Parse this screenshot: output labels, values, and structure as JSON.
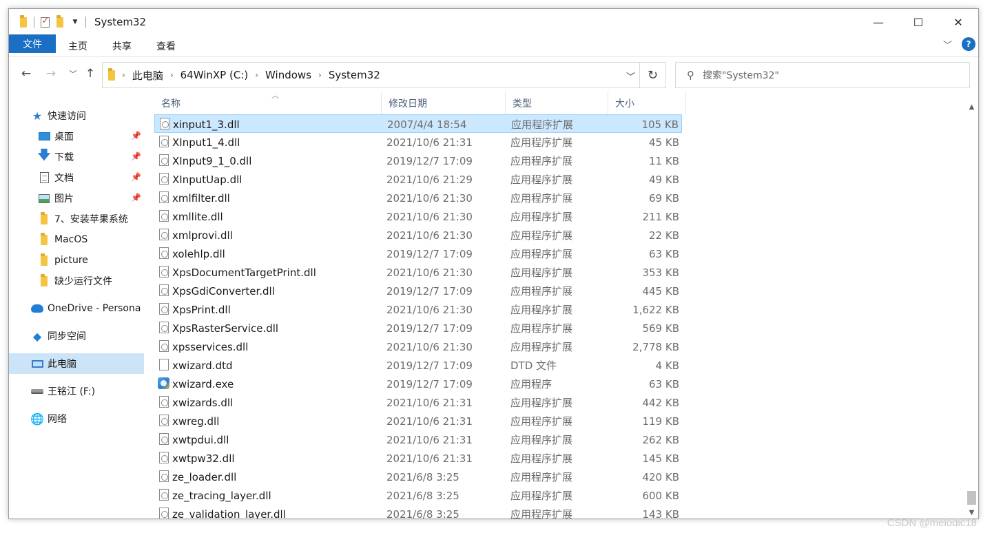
{
  "titlebar": {
    "title": "System32",
    "minimize_glyph": "—",
    "maximize_glyph": "☐",
    "close_glyph": "✕"
  },
  "ribbon": {
    "tabs": [
      "文件",
      "主页",
      "共享",
      "查看"
    ],
    "help_glyph": "?"
  },
  "address": {
    "crumbs": [
      "此电脑",
      "64WinXP  (C:)",
      "Windows",
      "System32"
    ]
  },
  "search": {
    "placeholder": "搜索\"System32\""
  },
  "sidebar": {
    "items": [
      {
        "label": "快速访问",
        "icon": "star-icon"
      },
      {
        "label": "桌面",
        "icon": "desktop-icon",
        "pinned": true
      },
      {
        "label": "下载",
        "icon": "download-icon",
        "pinned": true
      },
      {
        "label": "文档",
        "icon": "documents-icon",
        "pinned": true
      },
      {
        "label": "图片",
        "icon": "pictures-icon",
        "pinned": true
      },
      {
        "label": "7、安装苹果系统",
        "icon": "folder-icon"
      },
      {
        "label": "MacOS",
        "icon": "folder-icon"
      },
      {
        "label": "picture",
        "icon": "folder-icon"
      },
      {
        "label": "缺少运行文件",
        "icon": "folder-icon"
      },
      {
        "label": "OneDrive - Persona",
        "icon": "onedrive-icon"
      },
      {
        "label": "同步空间",
        "icon": "sync-icon"
      },
      {
        "label": "此电脑",
        "icon": "computer-icon",
        "selected": true
      },
      {
        "label": "王铭江 (F:)",
        "icon": "drive-icon"
      },
      {
        "label": "网络",
        "icon": "network-icon"
      }
    ]
  },
  "columns": {
    "name": "名称",
    "date": "修改日期",
    "type": "类型",
    "size": "大小"
  },
  "files": [
    {
      "name": "xinput1_3.dll",
      "date": "2007/4/4 18:54",
      "type": "应用程序扩展",
      "size": "105 KB",
      "icon": "dll",
      "selected": true
    },
    {
      "name": "XInput1_4.dll",
      "date": "2021/10/6 21:31",
      "type": "应用程序扩展",
      "size": "45 KB",
      "icon": "dll"
    },
    {
      "name": "XInput9_1_0.dll",
      "date": "2019/12/7 17:09",
      "type": "应用程序扩展",
      "size": "11 KB",
      "icon": "dll"
    },
    {
      "name": "XInputUap.dll",
      "date": "2021/10/6 21:29",
      "type": "应用程序扩展",
      "size": "49 KB",
      "icon": "dll"
    },
    {
      "name": "xmlfilter.dll",
      "date": "2021/10/6 21:30",
      "type": "应用程序扩展",
      "size": "69 KB",
      "icon": "dll"
    },
    {
      "name": "xmllite.dll",
      "date": "2021/10/6 21:30",
      "type": "应用程序扩展",
      "size": "211 KB",
      "icon": "dll"
    },
    {
      "name": "xmlprovi.dll",
      "date": "2021/10/6 21:30",
      "type": "应用程序扩展",
      "size": "22 KB",
      "icon": "dll"
    },
    {
      "name": "xolehlp.dll",
      "date": "2019/12/7 17:09",
      "type": "应用程序扩展",
      "size": "63 KB",
      "icon": "dll"
    },
    {
      "name": "XpsDocumentTargetPrint.dll",
      "date": "2021/10/6 21:30",
      "type": "应用程序扩展",
      "size": "353 KB",
      "icon": "dll"
    },
    {
      "name": "XpsGdiConverter.dll",
      "date": "2019/12/7 17:09",
      "type": "应用程序扩展",
      "size": "445 KB",
      "icon": "dll"
    },
    {
      "name": "XpsPrint.dll",
      "date": "2021/10/6 21:30",
      "type": "应用程序扩展",
      "size": "1,622 KB",
      "icon": "dll"
    },
    {
      "name": "XpsRasterService.dll",
      "date": "2019/12/7 17:09",
      "type": "应用程序扩展",
      "size": "569 KB",
      "icon": "dll"
    },
    {
      "name": "xpsservices.dll",
      "date": "2021/10/6 21:30",
      "type": "应用程序扩展",
      "size": "2,778 KB",
      "icon": "dll"
    },
    {
      "name": "xwizard.dtd",
      "date": "2019/12/7 17:09",
      "type": "DTD 文件",
      "size": "4 KB",
      "icon": "file"
    },
    {
      "name": "xwizard.exe",
      "date": "2019/12/7 17:09",
      "type": "应用程序",
      "size": "63 KB",
      "icon": "exe"
    },
    {
      "name": "xwizards.dll",
      "date": "2021/10/6 21:31",
      "type": "应用程序扩展",
      "size": "442 KB",
      "icon": "dll"
    },
    {
      "name": "xwreg.dll",
      "date": "2021/10/6 21:31",
      "type": "应用程序扩展",
      "size": "119 KB",
      "icon": "dll"
    },
    {
      "name": "xwtpdui.dll",
      "date": "2021/10/6 21:31",
      "type": "应用程序扩展",
      "size": "262 KB",
      "icon": "dll"
    },
    {
      "name": "xwtpw32.dll",
      "date": "2021/10/6 21:31",
      "type": "应用程序扩展",
      "size": "145 KB",
      "icon": "dll"
    },
    {
      "name": "ze_loader.dll",
      "date": "2021/6/8 3:25",
      "type": "应用程序扩展",
      "size": "420 KB",
      "icon": "dll"
    },
    {
      "name": "ze_tracing_layer.dll",
      "date": "2021/6/8 3:25",
      "type": "应用程序扩展",
      "size": "600 KB",
      "icon": "dll"
    },
    {
      "name": "ze_validation_layer.dll",
      "date": "2021/6/8 3:25",
      "type": "应用程序扩展",
      "size": "143 KB",
      "icon": "dll"
    }
  ],
  "watermark": "CSDN @melodic18",
  "colors": {
    "accent": "#1a6fc4",
    "selection": "#cce8ff",
    "header_text": "#4c607a",
    "muted_text": "#6d6d6d"
  }
}
